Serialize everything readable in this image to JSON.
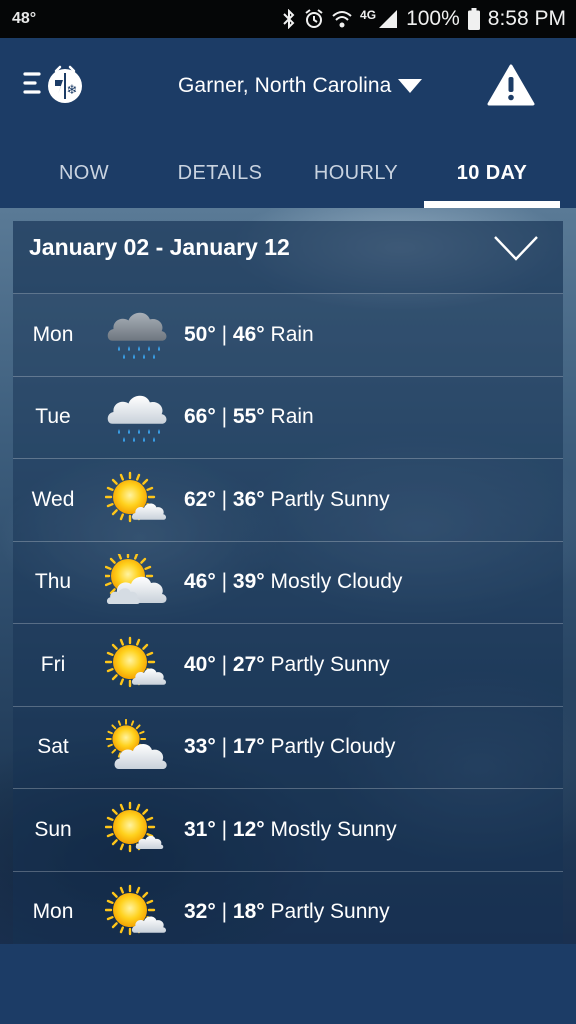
{
  "status_bar": {
    "temperature": "48°",
    "network": "4G",
    "battery": "100%",
    "time": "8:58 PM"
  },
  "header": {
    "location": "Garner, North Carolina",
    "icons": [
      "menu-icon",
      "weatherbug-logo-icon",
      "caret-down-icon",
      "alert-warning-icon"
    ]
  },
  "tabs": [
    {
      "label": "NOW"
    },
    {
      "label": "DETAILS"
    },
    {
      "label": "HOURLY"
    },
    {
      "label": "10 DAY"
    }
  ],
  "active_tab": "10 DAY",
  "forecast": {
    "date_range": "January 02 - January 12",
    "days": [
      {
        "day": "Mon",
        "high": "50°",
        "sep": "|",
        "low": "46°",
        "condition": "Rain",
        "icon": "rain-cloud-dark-icon"
      },
      {
        "day": "Tue",
        "high": "66°",
        "sep": "|",
        "low": "55°",
        "condition": "Rain",
        "icon": "rain-cloud-icon"
      },
      {
        "day": "Wed",
        "high": "62°",
        "sep": "|",
        "low": "36°",
        "condition": "Partly Sunny",
        "icon": "partly-sunny-icon"
      },
      {
        "day": "Thu",
        "high": "46°",
        "sep": "|",
        "low": "39°",
        "condition": "Mostly Cloudy",
        "icon": "mostly-cloudy-icon"
      },
      {
        "day": "Fri",
        "high": "40°",
        "sep": "|",
        "low": "27°",
        "condition": "Partly Sunny",
        "icon": "partly-sunny-icon"
      },
      {
        "day": "Sat",
        "high": "33°",
        "sep": "|",
        "low": "17°",
        "condition": "Partly Cloudy",
        "icon": "partly-cloudy-icon"
      },
      {
        "day": "Sun",
        "high": "31°",
        "sep": "|",
        "low": "12°",
        "condition": "Mostly Sunny",
        "icon": "mostly-sunny-icon"
      },
      {
        "day": "Mon",
        "high": "32°",
        "sep": "|",
        "low": "18°",
        "condition": "Partly Sunny",
        "icon": "partly-sunny-icon"
      }
    ]
  },
  "colors": {
    "header_bg": "#1c3c66",
    "status_bar_bg": "#050607",
    "active_tab_underline": "#ffffff",
    "sun": "#ffc61a",
    "cloud": "#e9eef3",
    "rain": "#3aa0e8"
  }
}
